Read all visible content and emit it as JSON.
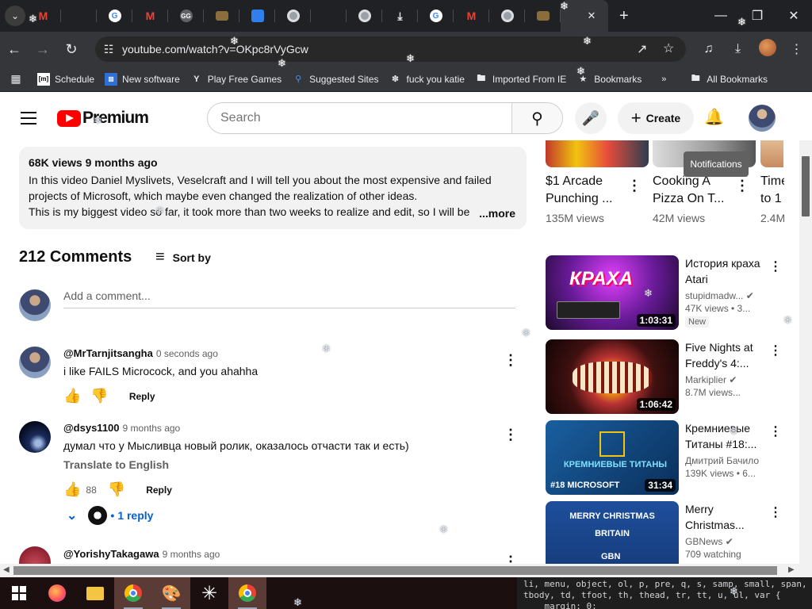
{
  "browser": {
    "tabs": [
      {
        "icon": "gmail-icon"
      },
      {
        "icon": "youtube-icon"
      },
      {
        "icon": "google-icon"
      },
      {
        "icon": "gmail-icon"
      },
      {
        "icon": "gg-icon"
      },
      {
        "icon": "folder-icon"
      },
      {
        "icon": "blue-app-icon"
      },
      {
        "icon": "chrome-icon"
      },
      {
        "icon": "youtube-icon"
      },
      {
        "icon": "chrome-icon"
      },
      {
        "icon": "download-icon"
      },
      {
        "icon": "google-icon"
      },
      {
        "icon": "gmail-icon"
      },
      {
        "icon": "chrome-icon"
      },
      {
        "icon": "folder-icon"
      }
    ],
    "url": "youtube.com/watch?v=OKpc8rVyGcw",
    "bookmarks": [
      {
        "label": "Schedule",
        "icon": "schedule-icon"
      },
      {
        "label": "New software",
        "icon": "software-icon"
      },
      {
        "label": "Play Free Games",
        "icon": "games-icon"
      },
      {
        "label": "Suggested Sites",
        "icon": "suggested-icon"
      },
      {
        "label": "fuck you katie",
        "icon": "bookmark-user-icon"
      },
      {
        "label": "Imported From IE",
        "icon": "folder-icon"
      },
      {
        "label": "Bookmarks",
        "icon": "star-icon"
      }
    ],
    "all_bookmarks": "All Bookmarks"
  },
  "youtube": {
    "logo_text": "Premium",
    "search_placeholder": "Search",
    "create_label": "Create",
    "notifications_tooltip": "Notifications",
    "description": {
      "meta": "68K views  9 months ago",
      "lines": [
        "In this video Daniel Myslivets, Veselcraft and I will tell you about the most expensive and failed",
        "projects of Microsoft, which maybe even changed the realization of other ideas.",
        "This is my biggest video so far, it took more than two weeks to realize and edit, so I will be v"
      ],
      "more": "...more"
    },
    "comments": {
      "count_label": "212 Comments",
      "sort_label": "Sort by",
      "add_placeholder": "Add a comment...",
      "items": [
        {
          "author": "@MrTarnjitsangha",
          "time": "0 seconds ago",
          "text": "i like FAILS Microcock, and you ahahha",
          "likes": "",
          "reply": "Reply"
        },
        {
          "author": "@dsys1100",
          "time": "9 months ago",
          "text": "думал что у Мысливца новый ролик, оказалось отчасти так и есть)",
          "translate": "Translate to English",
          "likes": "88",
          "reply": "Reply",
          "replies": "1 reply"
        },
        {
          "author": "@YorishyTakagawa",
          "time": "9 months ago"
        }
      ]
    },
    "top_shelf": [
      {
        "title": "$1 Arcade Punching ...",
        "views": "135M views"
      },
      {
        "title": "Cooking A Pizza On T...",
        "views": "42M views"
      },
      {
        "title": "Time to 1...",
        "views": "2.4M"
      }
    ],
    "recommended": [
      {
        "title": "История краха Atari",
        "channel": "stupidmadw...",
        "views": "47K views • 3...",
        "badge": "New",
        "duration": "1:03:31",
        "thumb_text": "КРАХА"
      },
      {
        "title": "Five Nights at Freddy's 4:...",
        "channel": "Markiplier",
        "views": "8.7M views...",
        "duration": "1:06:42"
      },
      {
        "title": "Кремниевые Титаны #18:...",
        "channel": "Дмитрий Бачило",
        "views": "139K views • 6...",
        "duration": "31:34",
        "thumb_text": "КРЕМНИЕВЫЕ ТИТАНЫ",
        "thumb_sub": "#18 MICROSOFT"
      },
      {
        "title": "Merry Christmas...",
        "channel": "GBNews",
        "views": "709 watching",
        "thumb_text": "MERRY CHRISTMAS BRITAIN",
        "thumb_sub": "GBN"
      }
    ]
  },
  "code_snippet": [
    "li, menu, object, ol, p, pre, q, s, samp, small, span, s",
    "tbody, td, tfoot, th, thead, tr, tt, u, ul, var {",
    "    margin: 0;"
  ]
}
